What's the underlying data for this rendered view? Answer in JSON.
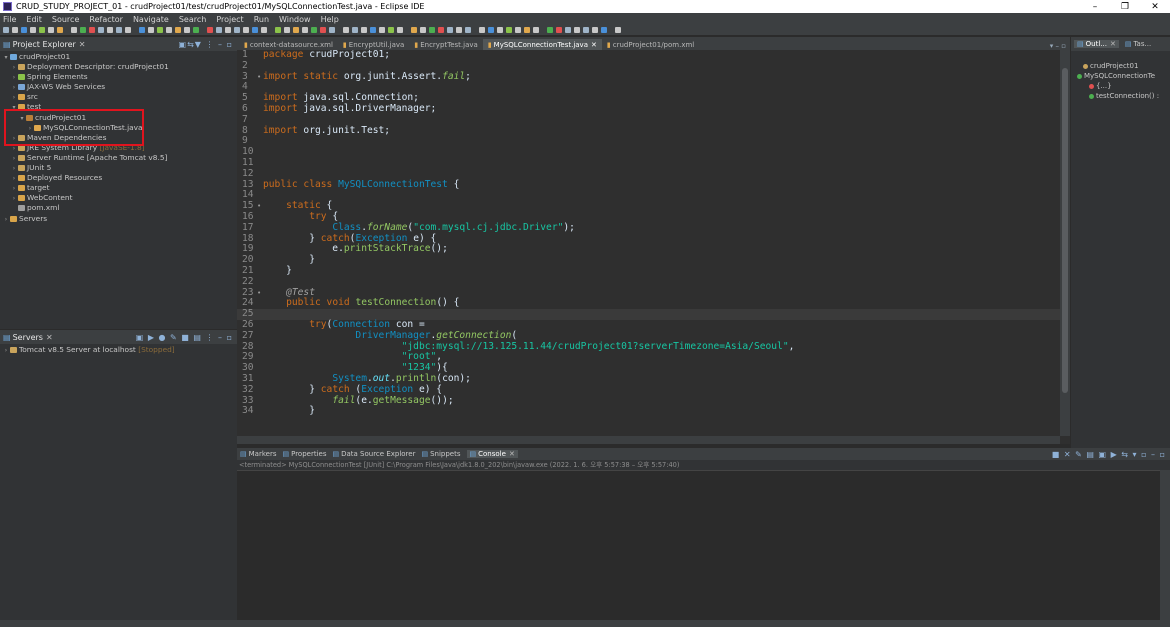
{
  "window": {
    "title": "CRUD_STUDY_PROJECT_01 - crudProject01/test/crudProject01/MySQLConnectionTest.java - Eclipse IDE",
    "minimize": "–",
    "maximize": "❐",
    "close": "✕"
  },
  "menu": [
    "File",
    "Edit",
    "Source",
    "Refactor",
    "Navigate",
    "Search",
    "Project",
    "Run",
    "Window",
    "Help"
  ],
  "project_explorer": {
    "title": "Project Explorer",
    "items": [
      {
        "label": "crudProject01",
        "depth": 0,
        "arrow": "▾",
        "color": "#6fa8dc"
      },
      {
        "label": "Deployment Descriptor: crudProject01",
        "depth": 1,
        "arrow": "›",
        "color": "#c9a45c"
      },
      {
        "label": "Spring Elements",
        "depth": 1,
        "arrow": "›",
        "color": "#8bc34a"
      },
      {
        "label": "JAX-WS Web Services",
        "depth": 1,
        "arrow": "›",
        "color": "#7aa6d6"
      },
      {
        "label": "src",
        "depth": 1,
        "arrow": "›",
        "color": "#d9a54a"
      },
      {
        "label": "test",
        "depth": 1,
        "arrow": "▾",
        "color": "#d9a54a"
      },
      {
        "label": "crudProject01",
        "depth": 2,
        "arrow": "▾",
        "color": "#b97f3a"
      },
      {
        "label": "MySQLConnectionTest.java",
        "depth": 3,
        "arrow": "›",
        "color": "#e0a84d"
      },
      {
        "label": "Maven Dependencies",
        "depth": 1,
        "arrow": "›",
        "color": "#c9a45c"
      },
      {
        "label": "JRE System Library",
        "suffix": "[JavaSE-1.8]",
        "depth": 1,
        "arrow": "›",
        "color": "#c9a45c"
      },
      {
        "label": "Server Runtime [Apache Tomcat v8.5]",
        "depth": 1,
        "arrow": "›",
        "color": "#c9a45c"
      },
      {
        "label": "JUnit 5",
        "depth": 1,
        "arrow": "›",
        "color": "#c9a45c"
      },
      {
        "label": "Deployed Resources",
        "depth": 1,
        "arrow": "›",
        "color": "#d9a54a"
      },
      {
        "label": "target",
        "depth": 1,
        "arrow": "›",
        "color": "#d9a54a"
      },
      {
        "label": "WebContent",
        "depth": 1,
        "arrow": "›",
        "color": "#d9a54a"
      },
      {
        "label": "pom.xml",
        "depth": 1,
        "arrow": "",
        "color": "#9e9e9e"
      },
      {
        "label": "Servers",
        "depth": 0,
        "arrow": "›",
        "color": "#d9a54a"
      }
    ]
  },
  "servers": {
    "title": "Servers",
    "items": [
      {
        "label": "Tomcat v8.5 Server at localhost",
        "suffix": "[Stopped]"
      }
    ]
  },
  "editor": {
    "tabs": [
      {
        "label": "context-datasource.xml",
        "active": false
      },
      {
        "label": "EncryptUtil.java",
        "active": false
      },
      {
        "label": "EncryptTest.java",
        "active": false
      },
      {
        "label": "MySQLConnectionTest.java",
        "active": true
      },
      {
        "label": "crudProject01/pom.xml",
        "active": false
      }
    ],
    "current_line": 25,
    "lines": [
      {
        "n": "1",
        "m": "",
        "t": [
          [
            "kw",
            "package"
          ],
          [
            "code",
            " crudProject01;"
          ]
        ]
      },
      {
        "n": "2",
        "m": "",
        "t": []
      },
      {
        "n": "3",
        "m": "•",
        "t": [
          [
            "kw",
            "import static"
          ],
          [
            "code",
            " org.junit.Assert."
          ],
          [
            "mth ital",
            "fail"
          ],
          [
            "code",
            ";"
          ]
        ]
      },
      {
        "n": "4",
        "m": "",
        "t": []
      },
      {
        "n": "5",
        "m": "",
        "t": [
          [
            "kw",
            "import"
          ],
          [
            "code",
            " java.sql.Connection;"
          ]
        ]
      },
      {
        "n": "6",
        "m": "",
        "t": [
          [
            "kw",
            "import"
          ],
          [
            "code",
            " java.sql.DriverManager;"
          ]
        ]
      },
      {
        "n": "7",
        "m": "",
        "t": []
      },
      {
        "n": "8",
        "m": "",
        "t": [
          [
            "kw",
            "import"
          ],
          [
            "code",
            " org.junit.Test;"
          ]
        ]
      },
      {
        "n": "9",
        "m": "",
        "t": []
      },
      {
        "n": "10",
        "m": "",
        "t": []
      },
      {
        "n": "11",
        "m": "",
        "t": []
      },
      {
        "n": "12",
        "m": "",
        "t": []
      },
      {
        "n": "13",
        "m": "",
        "t": [
          [
            "kw",
            "public class"
          ],
          [
            "code",
            " "
          ],
          [
            "cls",
            "MySQLConnectionTest"
          ],
          [
            "code",
            " {"
          ]
        ]
      },
      {
        "n": "14",
        "m": "",
        "t": []
      },
      {
        "n": "15",
        "m": "•",
        "t": [
          [
            "code",
            "    "
          ],
          [
            "kw",
            "static"
          ],
          [
            "code",
            " {"
          ]
        ]
      },
      {
        "n": "16",
        "m": "",
        "t": [
          [
            "code",
            "        "
          ],
          [
            "kw",
            "try"
          ],
          [
            "code",
            " {"
          ]
        ]
      },
      {
        "n": "17",
        "m": "",
        "t": [
          [
            "code",
            "            "
          ],
          [
            "cls",
            "Class"
          ],
          [
            "code",
            "."
          ],
          [
            "mth ital",
            "forName"
          ],
          [
            "code",
            "("
          ],
          [
            "str",
            "\"com.mysql.cj.jdbc.Driver\""
          ],
          [
            "code",
            ");"
          ]
        ]
      },
      {
        "n": "18",
        "m": "",
        "t": [
          [
            "code",
            "        } "
          ],
          [
            "kw",
            "catch"
          ],
          [
            "code",
            "("
          ],
          [
            "cls",
            "Exception"
          ],
          [
            "code",
            " e) {"
          ]
        ]
      },
      {
        "n": "19",
        "m": "",
        "t": [
          [
            "code",
            "            e."
          ],
          [
            "mth",
            "printStackTrace"
          ],
          [
            "code",
            "();"
          ]
        ]
      },
      {
        "n": "20",
        "m": "",
        "t": [
          [
            "code",
            "        }"
          ]
        ]
      },
      {
        "n": "21",
        "m": "",
        "t": [
          [
            "code",
            "    }"
          ]
        ]
      },
      {
        "n": "22",
        "m": "",
        "t": []
      },
      {
        "n": "23",
        "m": "•",
        "t": [
          [
            "code",
            "    "
          ],
          [
            "ann ital",
            "@Test"
          ]
        ]
      },
      {
        "n": "24",
        "m": "",
        "t": [
          [
            "code",
            "    "
          ],
          [
            "kw",
            "public void"
          ],
          [
            "code",
            " "
          ],
          [
            "mth",
            "testConnection"
          ],
          [
            "code",
            "() {"
          ]
        ]
      },
      {
        "n": "25",
        "m": "",
        "t": []
      },
      {
        "n": "26",
        "m": "",
        "t": [
          [
            "code",
            "        "
          ],
          [
            "kw",
            "try"
          ],
          [
            "code",
            "("
          ],
          [
            "cls",
            "Connection"
          ],
          [
            "code",
            " con ="
          ]
        ]
      },
      {
        "n": "27",
        "m": "",
        "t": [
          [
            "code",
            "                "
          ],
          [
            "cls",
            "DriverManager"
          ],
          [
            "code",
            "."
          ],
          [
            "mth ital",
            "getConnection"
          ],
          [
            "code",
            "("
          ]
        ]
      },
      {
        "n": "28",
        "m": "",
        "t": [
          [
            "code",
            "                        "
          ],
          [
            "str",
            "\"jdbc:mysql://13.125.11.44/crudProject01?serverTimezone=Asia/Seoul\""
          ],
          [
            "code",
            ","
          ]
        ]
      },
      {
        "n": "29",
        "m": "",
        "t": [
          [
            "code",
            "                        "
          ],
          [
            "str",
            "\"root\""
          ],
          [
            "code",
            ","
          ]
        ]
      },
      {
        "n": "30",
        "m": "",
        "t": [
          [
            "code",
            "                        "
          ],
          [
            "str",
            "\"1234\""
          ],
          [
            "code",
            "){"
          ]
        ]
      },
      {
        "n": "31",
        "m": "",
        "t": [
          [
            "code",
            "            "
          ],
          [
            "cls",
            "System"
          ],
          [
            "code",
            "."
          ],
          [
            "fld",
            "out"
          ],
          [
            "code",
            "."
          ],
          [
            "mth",
            "println"
          ],
          [
            "code",
            "(con);"
          ]
        ]
      },
      {
        "n": "32",
        "m": "",
        "t": [
          [
            "code",
            "        } "
          ],
          [
            "kw",
            "catch"
          ],
          [
            "code",
            " ("
          ],
          [
            "cls",
            "Exception"
          ],
          [
            "code",
            " e) {"
          ]
        ]
      },
      {
        "n": "33",
        "m": "",
        "t": [
          [
            "code",
            "            "
          ],
          [
            "mth ital",
            "fail"
          ],
          [
            "code",
            "(e."
          ],
          [
            "mth",
            "getMessage"
          ],
          [
            "code",
            "());"
          ]
        ]
      },
      {
        "n": "34",
        "m": "",
        "t": [
          [
            "code",
            "        }"
          ]
        ]
      }
    ]
  },
  "outline": {
    "tabs": [
      "Outl...",
      "Tas..."
    ],
    "items": [
      {
        "label": "crudProject01",
        "indent": 12,
        "color": "#c9a45c"
      },
      {
        "label": "MySQLConnectionTe",
        "indent": 6,
        "color": "#4caf50"
      },
      {
        "label": "{...}",
        "indent": 18,
        "color": "#e05050"
      },
      {
        "label": "testConnection() :",
        "indent": 18,
        "color": "#4caf50"
      }
    ]
  },
  "console": {
    "tabs": [
      {
        "label": "Markers",
        "active": false
      },
      {
        "label": "Properties",
        "active": false
      },
      {
        "label": "Data Source Explorer",
        "active": false
      },
      {
        "label": "Snippets",
        "active": false
      },
      {
        "label": "Console",
        "active": true
      }
    ],
    "description": "<terminated> MySQLConnectionTest [JUnit] C:\\Program Files\\Java\\jdk1.8.0_202\\bin\\javaw.exe  (2022. 1. 6. 오후 5:57:38 – 오후 5:57:40)"
  }
}
